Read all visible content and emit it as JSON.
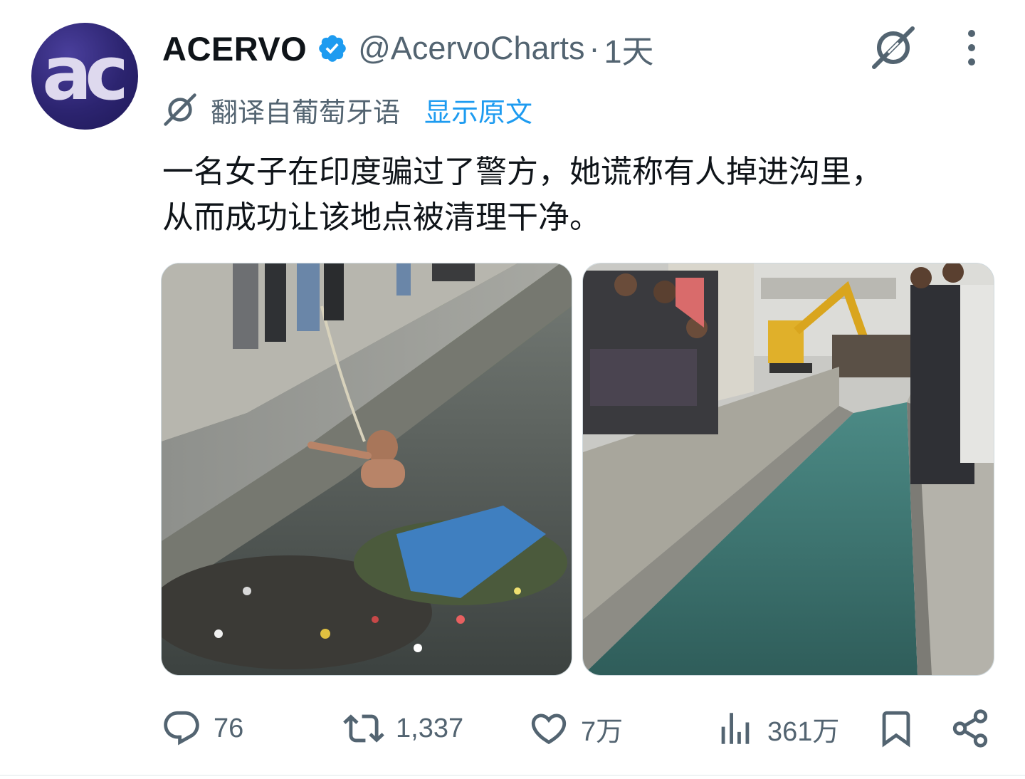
{
  "tweet": {
    "author": {
      "avatar_text": "ac",
      "display_name": "ACERVO",
      "handle": "@AcervoCharts",
      "verified": true
    },
    "separator": "·",
    "time": "1天",
    "translation": {
      "label": "翻译自葡萄牙语",
      "show_original": "显示原文"
    },
    "text_lines": [
      "一名女子在印度骗过了警方，她谎称有人掉进沟里，",
      "从而成功让该地点被清理干净。"
    ],
    "media": [
      {
        "name": "photo-dirty-canal",
        "description_icon": "photo"
      },
      {
        "name": "photo-clean-canal",
        "description_icon": "photo"
      }
    ],
    "actions": {
      "replies": "76",
      "retweets": "1,337",
      "likes": "7万",
      "views": "361万"
    }
  },
  "icons": {
    "verified": "verified-badge-icon",
    "grok": "grok-icon",
    "more": "more-vertical-icon",
    "reply": "reply-icon",
    "retweet": "retweet-icon",
    "like": "heart-icon",
    "views": "views-chart-icon",
    "bookmark": "bookmark-icon",
    "share": "share-icon"
  },
  "colors": {
    "text_primary": "#0f1419",
    "text_secondary": "#536471",
    "accent": "#1d9bf0",
    "avatar_bg": "#2c2470"
  }
}
